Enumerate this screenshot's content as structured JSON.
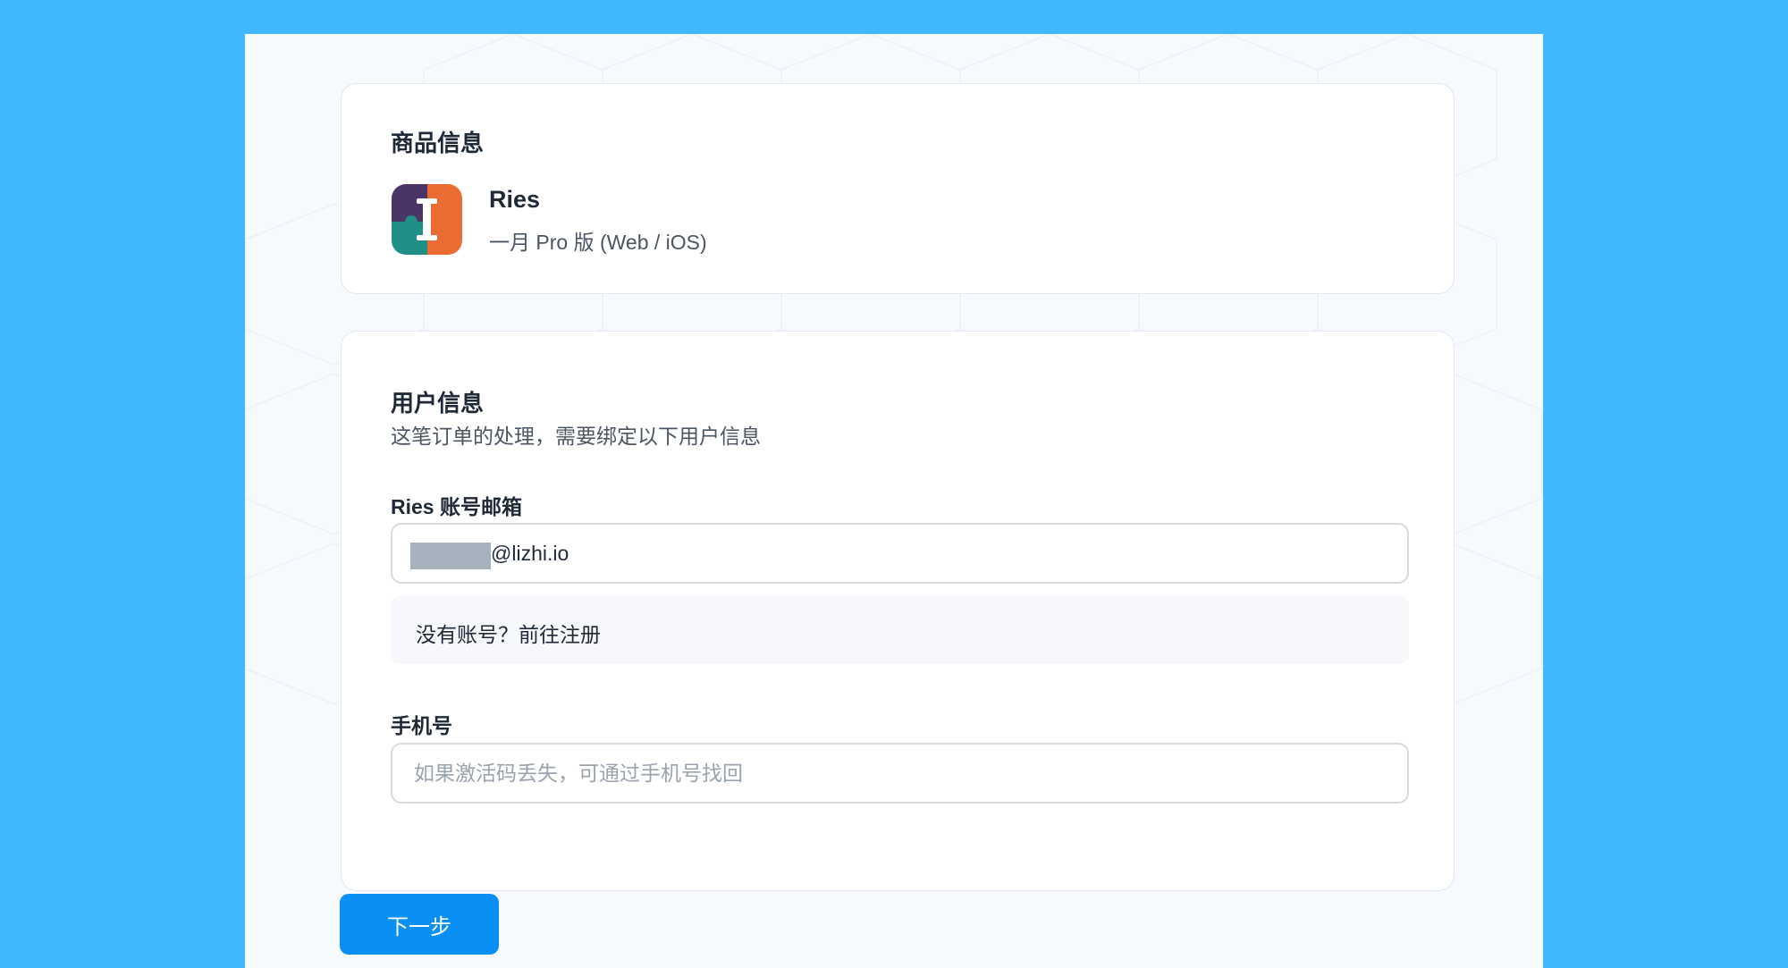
{
  "product_section": {
    "title": "商品信息",
    "app_icon": "ries-app-icon",
    "product_name": "Ries",
    "product_desc": "一月 Pro 版 (Web / iOS)"
  },
  "user_section": {
    "title": "用户信息",
    "subtitle": "这笔订单的处理，需要绑定以下用户信息",
    "email_label": "Ries 账号邮箱",
    "email_value": "@lizhi.io",
    "hint_prefix": "没有账号？",
    "hint_link": "前往注册",
    "phone_label": "手机号",
    "phone_placeholder": "如果激活码丢失，可通过手机号找回"
  },
  "actions": {
    "next_label": "下一步"
  },
  "colors": {
    "page_background": "#41b8fd",
    "panel_background": "#f6f9fd",
    "primary_button": "#0a8ff5",
    "redaction": "#a5b1bd"
  }
}
